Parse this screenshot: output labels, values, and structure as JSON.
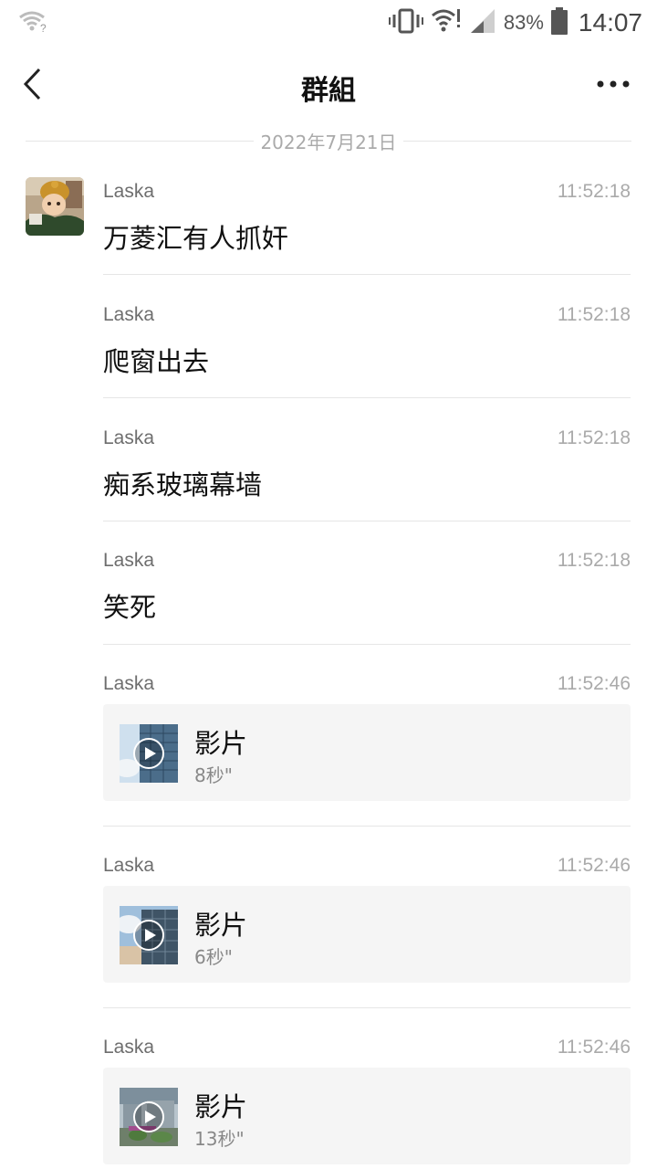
{
  "status_bar": {
    "battery": "83%",
    "time": "14:07",
    "wifi_left_icon": "wifi-unknown-icon",
    "icons": [
      "vibrate-icon",
      "wifi-alert-icon",
      "signal-icon",
      "battery-icon"
    ]
  },
  "header": {
    "title": "群組",
    "back_icon": "chevron-left-icon",
    "more_icon": "more-dots-icon"
  },
  "date_separator": "2022年7月21日",
  "messages": [
    {
      "sender": "Laska",
      "time": "11:52:18",
      "text": "万菱汇有人抓奸"
    },
    {
      "sender": "Laska",
      "time": "11:52:18",
      "text": "爬窗出去"
    },
    {
      "sender": "Laska",
      "time": "11:52:18",
      "text": "痴系玻璃幕墙"
    },
    {
      "sender": "Laska",
      "time": "11:52:18",
      "text": "笑死"
    },
    {
      "sender": "Laska",
      "time": "11:52:46",
      "video_label": "影片",
      "duration": "8秒\""
    },
    {
      "sender": "Laska",
      "time": "11:52:46",
      "video_label": "影片",
      "duration": "6秒\""
    },
    {
      "sender": "Laska",
      "time": "11:52:46",
      "video_label": "影片",
      "duration": "13秒\""
    }
  ],
  "colors": {
    "card_bg": "#f5f5f5",
    "divider": "#e6e6e6",
    "secondary_text": "#6e6e6e",
    "muted_text": "#aaaaaa"
  }
}
